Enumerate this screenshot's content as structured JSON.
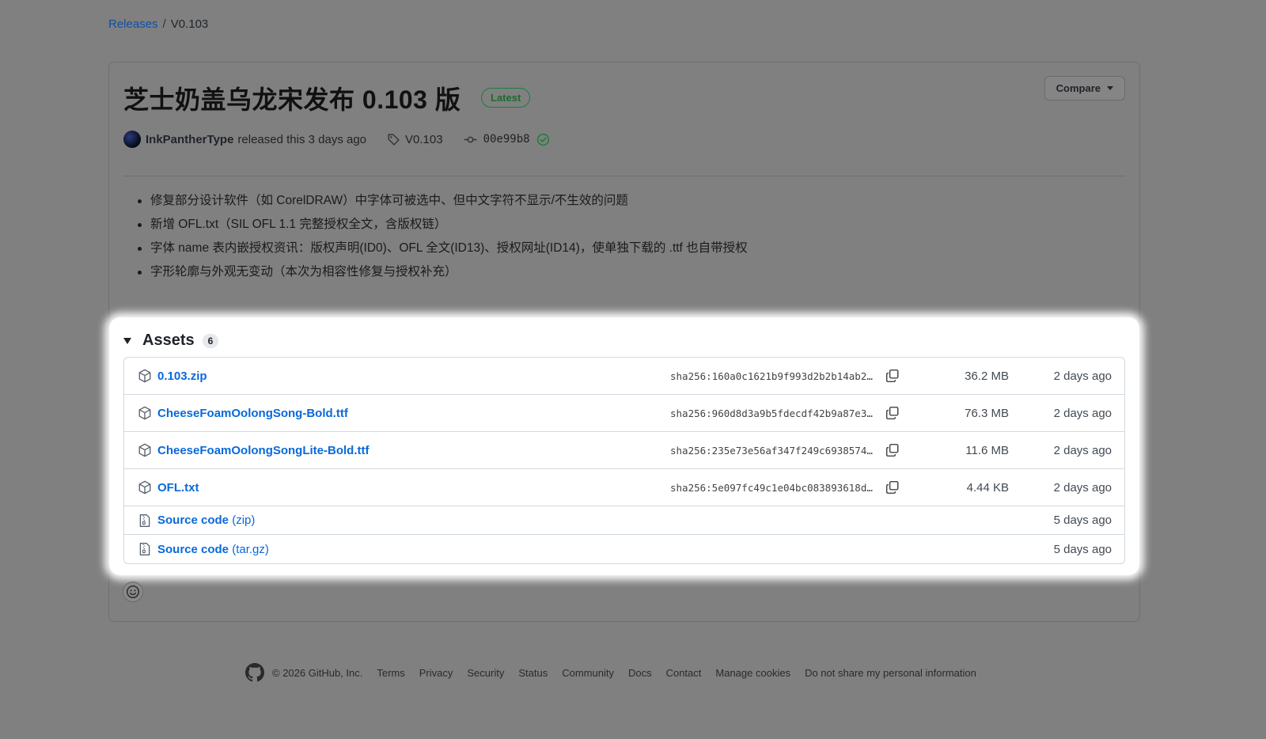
{
  "breadcrumb": {
    "releases": "Releases",
    "sep": "/",
    "current": "V0.103"
  },
  "release": {
    "title": "芝士奶盖乌龙宋发布 0.103 版",
    "badge": "Latest",
    "compare": "Compare",
    "author": "InkPantherType",
    "released_text": "released this 3 days ago",
    "tag": "V0.103",
    "commit": "00e99b8",
    "notes": [
      "修复部分设计软件（如 CorelDRAW）中字体可被选中、但中文字符不显示/不生效的问题",
      "新增 OFL.txt（SIL OFL 1.1 完整授权全文，含版权链）",
      "字体 name 表内嵌授权资讯：版权声明(ID0)、OFL 全文(ID13)、授权网址(ID14)，使单独下载的 .ttf 也自带授权",
      "字形轮廓与外观无变动（本次为相容性修复与授权补充）"
    ]
  },
  "assets": {
    "title": "Assets",
    "count": "6",
    "items": [
      {
        "name": "0.103.zip",
        "sha": "sha256:160a0c1621b9f993d2b2b14ab2…",
        "size": "36.2 MB",
        "date": "2 days ago"
      },
      {
        "name": "CheeseFoamOolongSong-Bold.ttf",
        "sha": "sha256:960d8d3a9b5fdecdf42b9a87e3…",
        "size": "76.3 MB",
        "date": "2 days ago"
      },
      {
        "name": "CheeseFoamOolongSongLite-Bold.ttf",
        "sha": "sha256:235e73e56af347f249c6938574…",
        "size": "11.6 MB",
        "date": "2 days ago"
      },
      {
        "name": "OFL.txt",
        "sha": "sha256:5e097fc49c1e04bc083893618d…",
        "size": "4.44 KB",
        "date": "2 days ago"
      }
    ],
    "source": [
      {
        "name": "Source code",
        "suffix": "(zip)",
        "date": "5 days ago"
      },
      {
        "name": "Source code",
        "suffix": "(tar.gz)",
        "date": "5 days ago"
      }
    ]
  },
  "footer": {
    "copyright": "© 2026 GitHub, Inc.",
    "links": [
      "Terms",
      "Privacy",
      "Security",
      "Status",
      "Community",
      "Docs",
      "Contact",
      "Manage cookies",
      "Do not share my personal information"
    ]
  }
}
